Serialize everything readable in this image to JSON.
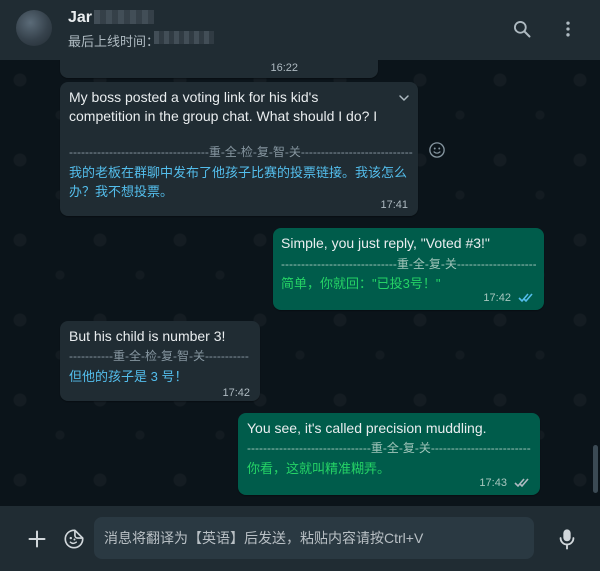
{
  "header": {
    "contact_name": "Jar",
    "last_seen_label": "最后上线时间：",
    "search_icon": "search-icon",
    "menu_icon": "kebab-menu-icon"
  },
  "messages": [
    {
      "time": "16:22"
    },
    {
      "direction": "in",
      "text": "My boss posted a voting link for his kid's competition in the group chat. What should I do? I don't want to vote.",
      "separator": "-----------------------------------重-全-检-复-智-关----------------------------------",
      "translation": "我的老板在群聊中发布了他孩子比赛的投票链接。我该怎么办？我不想投票。",
      "time": "17:41"
    },
    {
      "direction": "out",
      "text": "Simple, you just reply, \"Voted #3!\"",
      "separator": "-----------------------------重-全-复-关------------------------------",
      "translation": "简单，你就回：\"已投3号！\"",
      "time": "17:42"
    },
    {
      "direction": "in",
      "text": "But his child is number 3!",
      "separator": "-----------重-全-检-复-智-关-----------",
      "translation": "但他的孩子是 3 号！",
      "time": "17:42"
    },
    {
      "direction": "out",
      "text": "You see, it's called precision muddling.",
      "separator": "-------------------------------重-全-复-关------------------------------",
      "translation": "你看，这就叫精准糊弄。",
      "time": "17:43"
    }
  ],
  "composer": {
    "placeholder": "消息将翻译为【英语】后发送，粘贴内容请按Ctrl+V"
  },
  "colors": {
    "incoming_bubble": "#202c33",
    "outgoing_bubble": "#005c4b",
    "translation_in": "#53bdeb",
    "translation_out": "#25d366",
    "read_ticks": "#53bdeb"
  }
}
